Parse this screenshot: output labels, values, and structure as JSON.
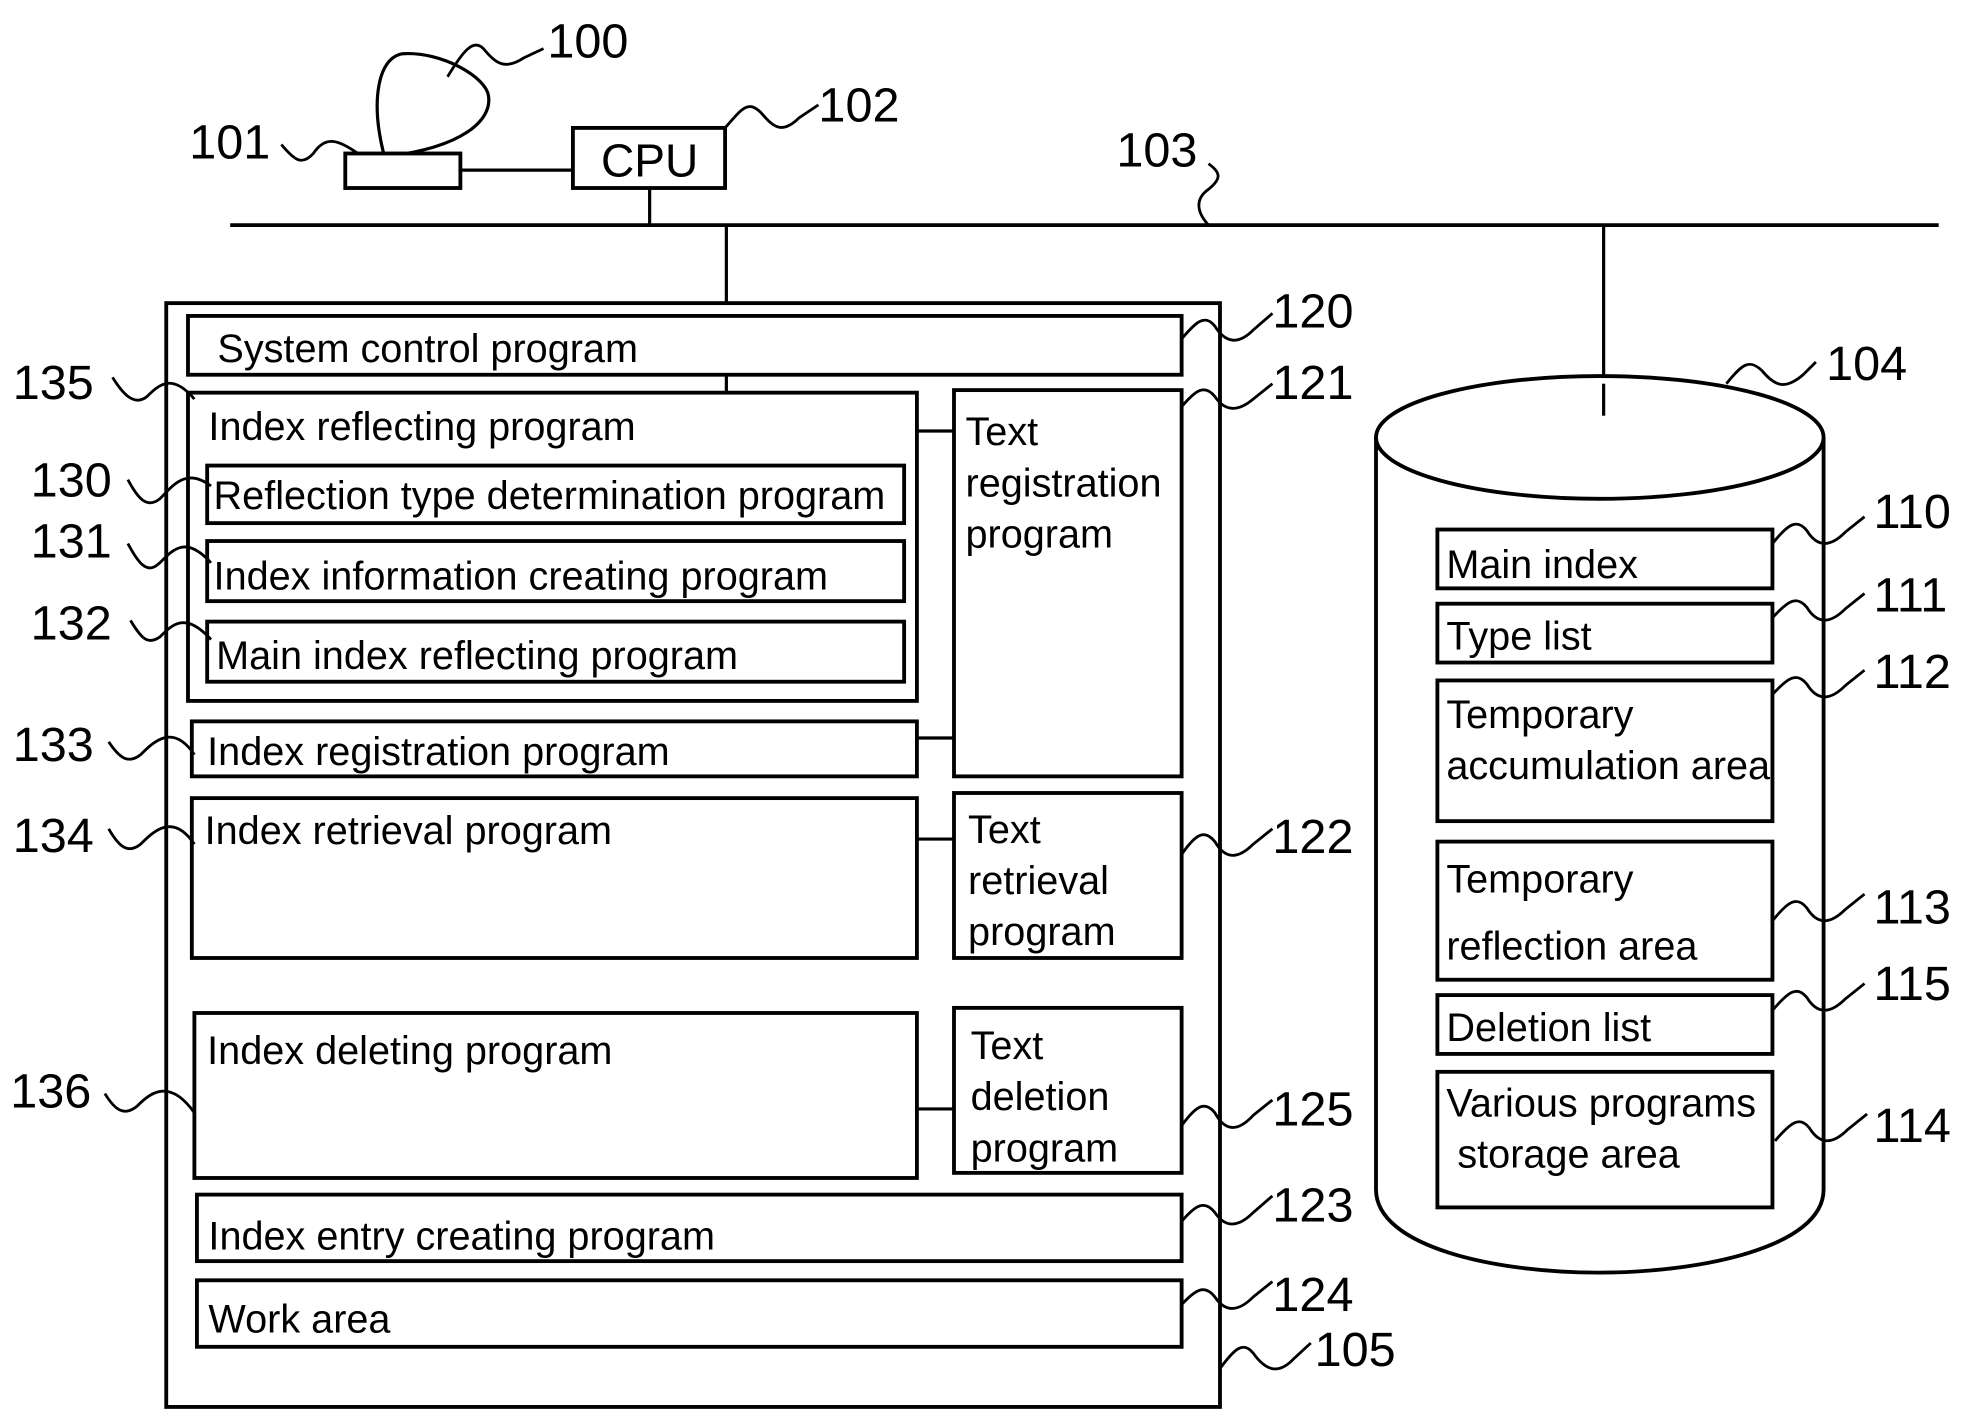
{
  "diagram": {
    "type": "block-diagram",
    "top": {
      "cpu_label": "CPU",
      "refs": {
        "display": "100",
        "keyboard": "101",
        "cpu": "102",
        "bus": "103"
      }
    },
    "memory": {
      "ref": "105",
      "blocks": [
        {
          "id": "system-control",
          "label": "System control program",
          "ref": "120"
        },
        {
          "id": "index-reflecting",
          "label": "Index reflecting program",
          "ref": "135",
          "children": [
            {
              "id": "reflection-type",
              "label": "Reflection type determination program",
              "ref": "130"
            },
            {
              "id": "index-info-creating",
              "label": "Index information creating program",
              "ref": "131"
            },
            {
              "id": "main-index-reflecting",
              "label": "Main index reflecting program",
              "ref": "132"
            }
          ]
        },
        {
          "id": "index-registration",
          "label": "Index registration program",
          "ref": "133"
        },
        {
          "id": "text-registration",
          "label_lines": [
            "Text",
            "registration",
            "program"
          ],
          "ref": "121"
        },
        {
          "id": "index-retrieval",
          "label": "Index retrieval program",
          "ref": "134"
        },
        {
          "id": "text-retrieval",
          "label_lines": [
            "Text",
            "retrieval",
            "program"
          ],
          "ref": "122"
        },
        {
          "id": "index-deleting",
          "label": "Index deleting program",
          "ref": "136"
        },
        {
          "id": "text-deletion",
          "label_lines": [
            "Text",
            "deletion",
            "program"
          ],
          "ref": "125"
        },
        {
          "id": "index-entry-creating",
          "label": "Index entry creating program",
          "ref": "123"
        },
        {
          "id": "work-area",
          "label": "Work area",
          "ref": "124"
        }
      ]
    },
    "storage": {
      "ref": "104",
      "blocks": [
        {
          "id": "main-index",
          "label_lines": [
            "Main index"
          ],
          "ref": "110"
        },
        {
          "id": "type-list",
          "label_lines": [
            "Type list"
          ],
          "ref": "111"
        },
        {
          "id": "temp-accumulation",
          "label_lines": [
            "Temporary",
            "accumulation area"
          ],
          "ref": "112"
        },
        {
          "id": "temp-reflection",
          "label_lines": [
            "Temporary",
            "reflection area"
          ],
          "ref": "113"
        },
        {
          "id": "deletion-list",
          "label_lines": [
            "Deletion list"
          ],
          "ref": "115"
        },
        {
          "id": "various-programs",
          "label_lines": [
            "Various programs",
            " storage area"
          ],
          "ref": "114"
        }
      ]
    }
  }
}
